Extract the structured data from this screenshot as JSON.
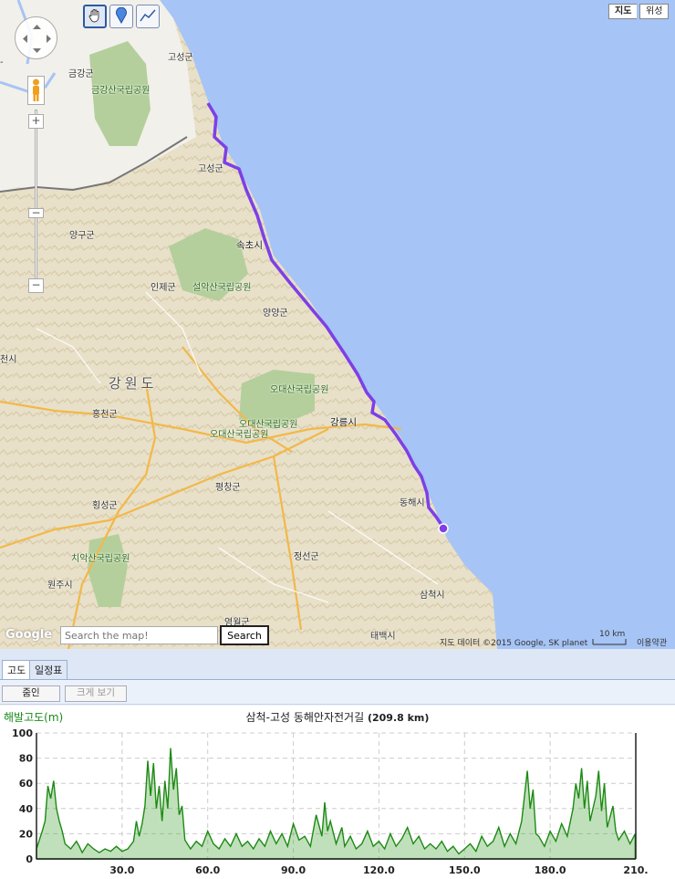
{
  "toolbar": {
    "tools": [
      {
        "name": "pan-tool",
        "icon": "hand-icon",
        "active": true
      },
      {
        "name": "marker-tool",
        "icon": "pin-icon",
        "active": false
      },
      {
        "name": "line-tool",
        "icon": "polyline-icon",
        "active": false
      }
    ]
  },
  "map_type": {
    "map_label": "지도",
    "satellite_label": "위성"
  },
  "map": {
    "labels": {
      "goseong_n": "고성군",
      "geumgang": "금강군",
      "geumgang_park": "금강산국립공원",
      "goseong": "고성군",
      "yanggu": "양구군",
      "sokcho": "속초시",
      "inje": "인제군",
      "seorak_park": "설악산국립공원",
      "yangyang": "양양군",
      "cheon": "천시",
      "gangwon": "강원도",
      "odae_park1": "오대산국립공원",
      "odae_park2": "오대산국립공원",
      "odae_park3": "오대산국립공원",
      "hongcheon": "홍천군",
      "gangneung": "강릉시",
      "pyeongchang": "평창군",
      "hoengseong": "횡성군",
      "donghae": "동해시",
      "chiak_park": "치악산국립공원",
      "jeongseon": "정선군",
      "wonju": "원주시",
      "samcheok": "삼척시",
      "yeongwol": "영월군",
      "taebaek": "태백시",
      "minus_partial": "-"
    },
    "colors": {
      "sea": "#a6c4f5",
      "land": "#eee8d6",
      "route": "#7e3fe6"
    }
  },
  "search": {
    "placeholder": "Search the map!",
    "button": "Search"
  },
  "credits": {
    "data": "지도 데이터 ©2015 Google, SK planet",
    "scale": "10 km",
    "terms": "이용약관",
    "logo": "Google"
  },
  "zoom": {
    "plus": "+",
    "minus": "−"
  },
  "panel": {
    "tabs": [
      "고도",
      "일정표"
    ],
    "zoom_in": "줌인",
    "enlarge": "크게 보기"
  },
  "chart_data": {
    "type": "area",
    "title": "삼척-고성 동해안자전거길",
    "distance": "(209.8 km)",
    "ylabel": "해발고도(m)",
    "xlim": [
      0,
      210
    ],
    "ylim": [
      0,
      100
    ],
    "yticks": [
      "0",
      "20",
      "40",
      "60",
      "80",
      "100"
    ],
    "xticks": [
      "30.0",
      "60.0",
      "90.0",
      "120.0",
      "150.0",
      "180.0",
      "210."
    ],
    "series": [
      {
        "values": [
          [
            0,
            8
          ],
          [
            2,
            22
          ],
          [
            3,
            30
          ],
          [
            4,
            58
          ],
          [
            5,
            48
          ],
          [
            6,
            62
          ],
          [
            7,
            40
          ],
          [
            8,
            30
          ],
          [
            9,
            22
          ],
          [
            10,
            12
          ],
          [
            12,
            8
          ],
          [
            14,
            14
          ],
          [
            15,
            10
          ],
          [
            16,
            5
          ],
          [
            18,
            12
          ],
          [
            20,
            8
          ],
          [
            22,
            5
          ],
          [
            24,
            8
          ],
          [
            26,
            6
          ],
          [
            28,
            10
          ],
          [
            30,
            6
          ],
          [
            32,
            8
          ],
          [
            34,
            14
          ],
          [
            35,
            30
          ],
          [
            36,
            18
          ],
          [
            37,
            28
          ],
          [
            38,
            42
          ],
          [
            39,
            78
          ],
          [
            40,
            50
          ],
          [
            41,
            76
          ],
          [
            42,
            40
          ],
          [
            43,
            58
          ],
          [
            44,
            30
          ],
          [
            45,
            62
          ],
          [
            46,
            40
          ],
          [
            47,
            88
          ],
          [
            48,
            55
          ],
          [
            49,
            72
          ],
          [
            50,
            35
          ],
          [
            51,
            42
          ],
          [
            52,
            15
          ],
          [
            54,
            8
          ],
          [
            56,
            14
          ],
          [
            58,
            10
          ],
          [
            60,
            22
          ],
          [
            62,
            12
          ],
          [
            64,
            8
          ],
          [
            66,
            16
          ],
          [
            68,
            10
          ],
          [
            70,
            20
          ],
          [
            72,
            10
          ],
          [
            74,
            14
          ],
          [
            76,
            8
          ],
          [
            78,
            16
          ],
          [
            80,
            10
          ],
          [
            82,
            22
          ],
          [
            84,
            12
          ],
          [
            86,
            20
          ],
          [
            88,
            10
          ],
          [
            90,
            28
          ],
          [
            92,
            15
          ],
          [
            94,
            18
          ],
          [
            96,
            10
          ],
          [
            98,
            35
          ],
          [
            100,
            18
          ],
          [
            101,
            45
          ],
          [
            102,
            22
          ],
          [
            103,
            30
          ],
          [
            105,
            12
          ],
          [
            107,
            25
          ],
          [
            108,
            10
          ],
          [
            110,
            18
          ],
          [
            112,
            8
          ],
          [
            114,
            12
          ],
          [
            116,
            22
          ],
          [
            118,
            10
          ],
          [
            120,
            14
          ],
          [
            122,
            8
          ],
          [
            124,
            20
          ],
          [
            126,
            10
          ],
          [
            128,
            16
          ],
          [
            130,
            25
          ],
          [
            132,
            12
          ],
          [
            134,
            18
          ],
          [
            136,
            8
          ],
          [
            138,
            12
          ],
          [
            140,
            8
          ],
          [
            142,
            14
          ],
          [
            144,
            6
          ],
          [
            146,
            10
          ],
          [
            148,
            4
          ],
          [
            150,
            8
          ],
          [
            152,
            12
          ],
          [
            154,
            6
          ],
          [
            156,
            18
          ],
          [
            158,
            10
          ],
          [
            160,
            14
          ],
          [
            162,
            25
          ],
          [
            164,
            10
          ],
          [
            166,
            20
          ],
          [
            168,
            12
          ],
          [
            170,
            30
          ],
          [
            171,
            50
          ],
          [
            172,
            70
          ],
          [
            173,
            40
          ],
          [
            174,
            55
          ],
          [
            175,
            20
          ],
          [
            176,
            18
          ],
          [
            178,
            10
          ],
          [
            180,
            22
          ],
          [
            182,
            14
          ],
          [
            184,
            28
          ],
          [
            186,
            18
          ],
          [
            188,
            40
          ],
          [
            189,
            60
          ],
          [
            190,
            48
          ],
          [
            191,
            72
          ],
          [
            192,
            40
          ],
          [
            193,
            62
          ],
          [
            194,
            30
          ],
          [
            196,
            50
          ],
          [
            197,
            70
          ],
          [
            198,
            38
          ],
          [
            199,
            60
          ],
          [
            200,
            25
          ],
          [
            202,
            42
          ],
          [
            203,
            22
          ],
          [
            204,
            15
          ],
          [
            206,
            22
          ],
          [
            208,
            12
          ],
          [
            209.8,
            20
          ]
        ]
      }
    ]
  }
}
